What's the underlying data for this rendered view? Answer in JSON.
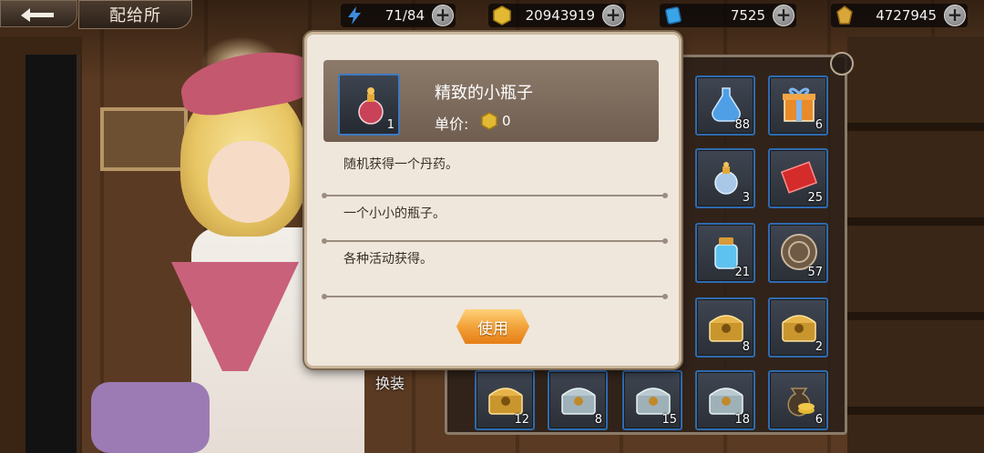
{
  "header": {
    "title": "配给所"
  },
  "resources": [
    {
      "name": "stamina",
      "value": "71/84",
      "icon": "lightning-icon",
      "color": "#3b8de0"
    },
    {
      "name": "gold",
      "value": "20943919",
      "icon": "gold-coin-icon",
      "color": "#e3b833"
    },
    {
      "name": "diamond",
      "value": "7525",
      "icon": "blue-crystal-icon",
      "color": "#3aa4e8"
    },
    {
      "name": "token",
      "value": "4727945",
      "icon": "gold-token-icon",
      "color": "#d8a63a"
    }
  ],
  "popup": {
    "item_name": "精致的小瓶子",
    "item_count": "1",
    "price_label": "单价:",
    "price_value": "0",
    "desc_effect": "随机获得一个丹药。",
    "desc_flavor": "一个小小的瓶子。",
    "desc_source": "各种活动获得。",
    "use_button": "使用"
  },
  "inventory": {
    "items": [
      {
        "icon": "blue-potion-icon",
        "count": "88"
      },
      {
        "icon": "gift-box-icon",
        "count": "6"
      },
      {
        "icon": "small-bottle-icon",
        "count": "3"
      },
      {
        "icon": "red-envelope-icon",
        "count": "25"
      },
      {
        "icon": "blue-jar-icon",
        "count": "21"
      },
      {
        "icon": "bronze-medal-icon",
        "count": "57"
      },
      {
        "icon": "gold-chest-icon",
        "count": "8"
      },
      {
        "icon": "gold-chest-icon",
        "count": "2"
      },
      {
        "icon": "gold-chest-icon",
        "count": "12"
      },
      {
        "icon": "silver-chest-icon",
        "count": "8"
      },
      {
        "icon": "silver-chest-icon",
        "count": "15"
      },
      {
        "icon": "silver-chest-icon",
        "count": "18"
      },
      {
        "icon": "coin-bag-icon",
        "count": "6"
      }
    ]
  },
  "character": {
    "swap_label": "换装"
  }
}
